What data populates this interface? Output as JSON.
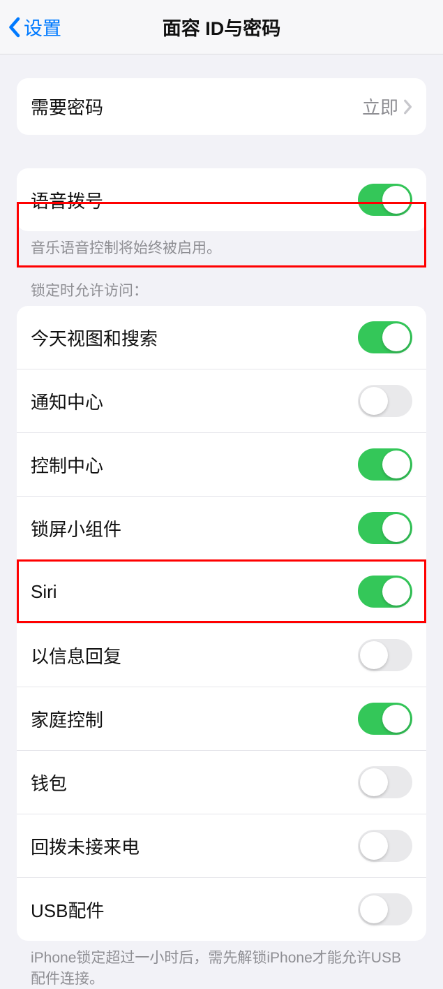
{
  "nav": {
    "back_label": "设置",
    "title": "面容 ID与密码"
  },
  "require_passcode": {
    "label": "需要密码",
    "value": "立即"
  },
  "voice_dial": {
    "label": "语音拨号",
    "on": true,
    "footer": "音乐语音控制将始终被启用。"
  },
  "lock_access": {
    "header": "锁定时允许访问：",
    "items": [
      {
        "label": "今天视图和搜索",
        "on": true
      },
      {
        "label": "通知中心",
        "on": false
      },
      {
        "label": "控制中心",
        "on": true
      },
      {
        "label": "锁屏小组件",
        "on": true
      },
      {
        "label": "Siri",
        "on": true
      },
      {
        "label": "以信息回复",
        "on": false
      },
      {
        "label": "家庭控制",
        "on": true
      },
      {
        "label": "钱包",
        "on": false
      },
      {
        "label": "回拨未接来电",
        "on": false
      },
      {
        "label": "USB配件",
        "on": false
      }
    ],
    "footer": "iPhone锁定超过一小时后，需先解锁iPhone才能允许USB配件连接。"
  }
}
